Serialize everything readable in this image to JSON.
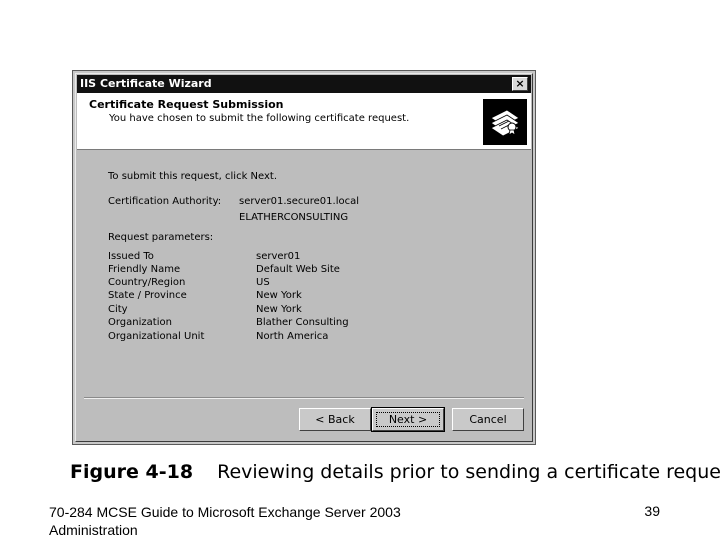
{
  "window": {
    "title": "IIS Certificate Wizard",
    "close_label": "×"
  },
  "header": {
    "title": "Certificate Request Submission",
    "subtitle": "You have chosen to submit the following certificate request.",
    "icon": "certificate-icon"
  },
  "body": {
    "instruction": "To submit this request, click Next.",
    "ca_label": "Certification Authority:",
    "ca_value_line1": "server01.secure01.local",
    "ca_value_line2": "ELATHERCONSULTING",
    "params_heading": "Request parameters:",
    "params": [
      {
        "key": "Issued To",
        "value": "server01"
      },
      {
        "key": "Friendly Name",
        "value": "Default Web Site"
      },
      {
        "key": "Country/Region",
        "value": "US"
      },
      {
        "key": "State / Province",
        "value": "New York"
      },
      {
        "key": "City",
        "value": "New York"
      },
      {
        "key": "Organization",
        "value": "Blather Consulting"
      },
      {
        "key": "Organizational Unit",
        "value": "North America"
      }
    ]
  },
  "buttons": {
    "back": "< Back",
    "next": "Next >",
    "cancel": "Cancel"
  },
  "caption": {
    "figure": "Figure 4-18",
    "text": "Reviewing details prior to sending a certificate request"
  },
  "footer": {
    "book_title": "70-284 MCSE Guide to Microsoft Exchange Server 2003 Administration",
    "page_number": "39"
  }
}
